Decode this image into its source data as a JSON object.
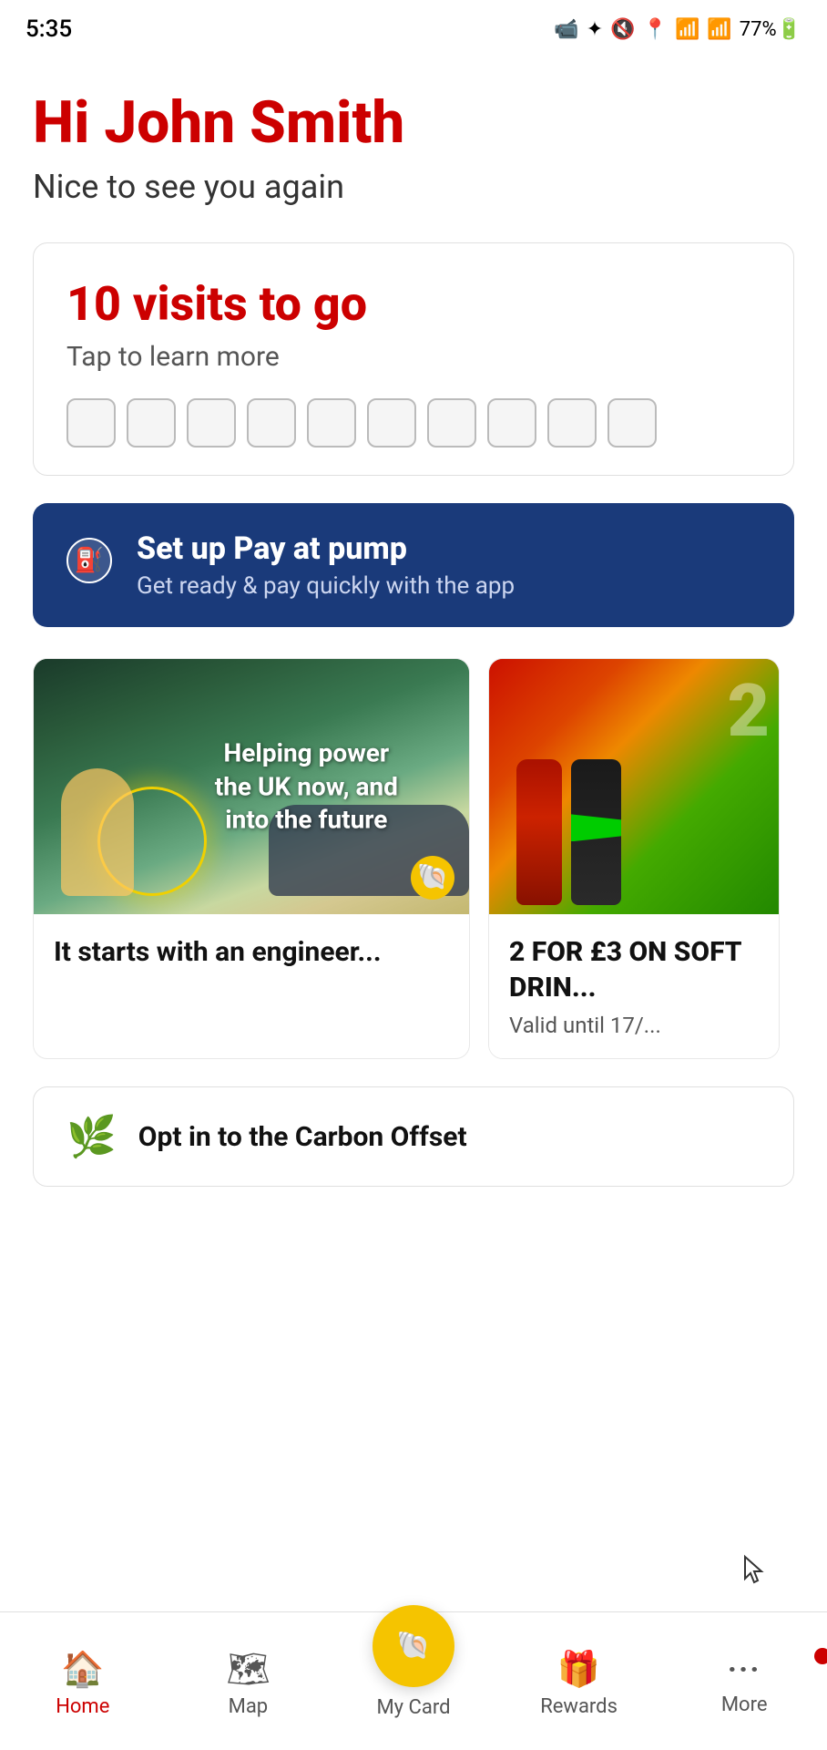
{
  "statusBar": {
    "time": "5:35",
    "icons": "🎦 ✦ 🔇 📍 📶 📶 77%🔋"
  },
  "greeting": {
    "name": "Hi John Smith",
    "subtitle": "Nice to see you again"
  },
  "visitsCard": {
    "title": "10 visits to go",
    "subtitle": "Tap to learn more",
    "boxCount": 10
  },
  "pumpBanner": {
    "title": "Set up Pay at pump",
    "subtitle": "Get ready & pay quickly with the app",
    "icon": "⛽"
  },
  "promoCards": [
    {
      "imageAlt": "EV charging image",
      "imageText": "Helping power the UK now, and into the future",
      "title": "It starts with an engineer..."
    },
    {
      "imageAlt": "Soft drinks promotion",
      "dealTitle": "2 FOR £3 ON SOFT DRIN...",
      "valid": "Valid until 17/..."
    }
  ],
  "offsetBanner": {
    "text": "Opt in to the Carbon Offset"
  },
  "bottomNav": {
    "items": [
      {
        "label": "Home",
        "icon": "🏠",
        "active": true
      },
      {
        "label": "Map",
        "icon": "🗺",
        "active": false
      },
      {
        "label": "My Card",
        "icon": "shell",
        "active": false,
        "center": true
      },
      {
        "label": "Rewards",
        "icon": "🎁",
        "active": false
      },
      {
        "label": "More",
        "icon": "···",
        "active": false,
        "badge": true
      }
    ]
  },
  "androidNav": {
    "back": "‹",
    "home": "○",
    "recents": "|||"
  }
}
